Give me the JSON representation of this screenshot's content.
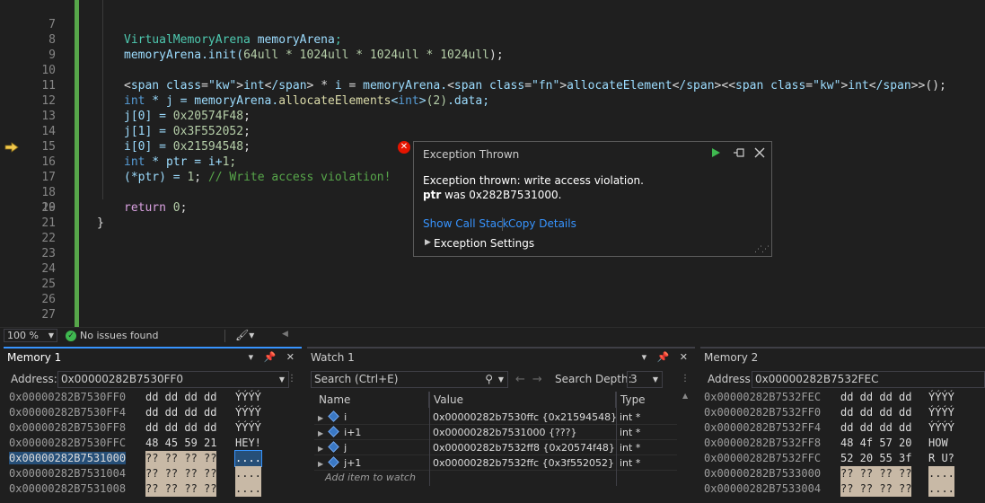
{
  "editor": {
    "lines": [
      {
        "num": "7"
      },
      {
        "num": "8"
      },
      {
        "num": "9"
      },
      {
        "num": "10"
      },
      {
        "num": "11"
      },
      {
        "num": "12"
      },
      {
        "num": "13"
      },
      {
        "num": "14"
      },
      {
        "num": "15"
      },
      {
        "num": "16"
      },
      {
        "num": "17"
      },
      {
        "num": "18"
      },
      {
        "num": "19"
      },
      {
        "num": "20"
      },
      {
        "num": "21"
      },
      {
        "num": "22"
      },
      {
        "num": "23"
      },
      {
        "num": "24"
      },
      {
        "num": "25"
      },
      {
        "num": "26"
      },
      {
        "num": "27"
      }
    ],
    "code": {
      "l7": "VirtualMemoryArena memoryArena;",
      "l8a": "memoryArena.init(",
      "l8b": "64ull * 1024ull * 1024ull * 1024ull",
      "l8c": ");",
      "l10": "int * i = memoryArena.allocateElement<int>();",
      "l11": "int * j = memoryArena.allocateElements<int>(2).data;",
      "l12a": "j[0] = ",
      "l12b": "0x20574F48",
      "l12c": ";",
      "l13a": "j[1] = ",
      "l13b": "0x3F552052",
      "l13c": ";",
      "l14a": "i[0] = ",
      "l14b": "0x21594548",
      "l14c": ";",
      "l15": "int * ptr = i+1;",
      "l16a": "(*ptr) = ",
      "l16b": "1",
      "l16c": "; ",
      "l16d": "// Write access violation!",
      "l18a": "return ",
      "l18b": "0",
      "l18c": ";",
      "l19": "}"
    },
    "error_glyph": "✕"
  },
  "exception": {
    "title": "Exception Thrown",
    "message_line1": "Exception thrown: write access violation.",
    "message_var": "ptr",
    "message_line2_rest": " was 0x282B7531000.",
    "call_stack_link": "Show Call Stack",
    "copy_details_link": "Copy Details",
    "settings_label": "Exception Settings",
    "icons": {
      "continue": "play-icon",
      "pin": "pin-icon",
      "close": "close-icon"
    }
  },
  "status": {
    "zoom": "100 %",
    "issues": "No issues found"
  },
  "memory1": {
    "title": "Memory 1",
    "address_label": "Address:",
    "address": "0x00000282B7530FF0",
    "rows": [
      {
        "addr": "0x00000282B7530FF0",
        "bytes": "dd dd dd dd",
        "ascii": "ÝÝÝÝ",
        "state": "known"
      },
      {
        "addr": "0x00000282B7530FF4",
        "bytes": "dd dd dd dd",
        "ascii": "ÝÝÝÝ",
        "state": "known"
      },
      {
        "addr": "0x00000282B7530FF8",
        "bytes": "dd dd dd dd",
        "ascii": "ÝÝÝÝ",
        "state": "known"
      },
      {
        "addr": "0x00000282B7530FFC",
        "bytes": "48 45 59 21",
        "ascii": "HEY!",
        "state": "known"
      },
      {
        "addr": "0x00000282B7531000",
        "bytes": "?? ?? ?? ??",
        "ascii": "....",
        "state": "selected"
      },
      {
        "addr": "0x00000282B7531004",
        "bytes": "?? ?? ?? ??",
        "ascii": "....",
        "state": "unknown"
      },
      {
        "addr": "0x00000282B7531008",
        "bytes": "?? ?? ?? ??",
        "ascii": "....",
        "state": "unknown"
      }
    ]
  },
  "watch1": {
    "title": "Watch 1",
    "search_placeholder": "Search (Ctrl+E)",
    "search_depth_label": "Search Depth:",
    "search_depth": "3",
    "columns": [
      "Name",
      "Value",
      "Type"
    ],
    "rows": [
      {
        "name": "i",
        "value": "0x00000282b7530ffc {0x21594548}",
        "type": "int *"
      },
      {
        "name": "i+1",
        "value": "0x00000282b7531000 {???}",
        "type": "int *"
      },
      {
        "name": "j",
        "value": "0x00000282b7532ff8 {0x20574f48}",
        "type": "int *"
      },
      {
        "name": "j+1",
        "value": "0x00000282b7532ffc {0x3f552052}",
        "type": "int *"
      }
    ],
    "add_item": "Add item to watch"
  },
  "memory2": {
    "title": "Memory 2",
    "address_label": "Address:",
    "address": "0x00000282B7532FEC",
    "rows": [
      {
        "addr": "0x00000282B7532FEC",
        "bytes": "dd dd dd dd",
        "ascii": "ÝÝÝÝ",
        "state": "known"
      },
      {
        "addr": "0x00000282B7532FF0",
        "bytes": "dd dd dd dd",
        "ascii": "ÝÝÝÝ",
        "state": "known"
      },
      {
        "addr": "0x00000282B7532FF4",
        "bytes": "dd dd dd dd",
        "ascii": "ÝÝÝÝ",
        "state": "known"
      },
      {
        "addr": "0x00000282B7532FF8",
        "bytes": "48 4f 57 20",
        "ascii": "HOW ",
        "state": "known"
      },
      {
        "addr": "0x00000282B7532FFC",
        "bytes": "52 20 55 3f",
        "ascii": "R U?",
        "state": "known"
      },
      {
        "addr": "0x00000282B7533000",
        "bytes": "?? ?? ?? ??",
        "ascii": "....",
        "state": "unknown"
      },
      {
        "addr": "0x00000282B7533004",
        "bytes": "?? ?? ?? ??",
        "ascii": "....",
        "state": "unknown"
      }
    ]
  },
  "colors": {
    "accent": "#3794ff",
    "error": "#e51400",
    "change_bar": "#57a64a",
    "unknown_bytes_bg": "#c8b9a6"
  }
}
